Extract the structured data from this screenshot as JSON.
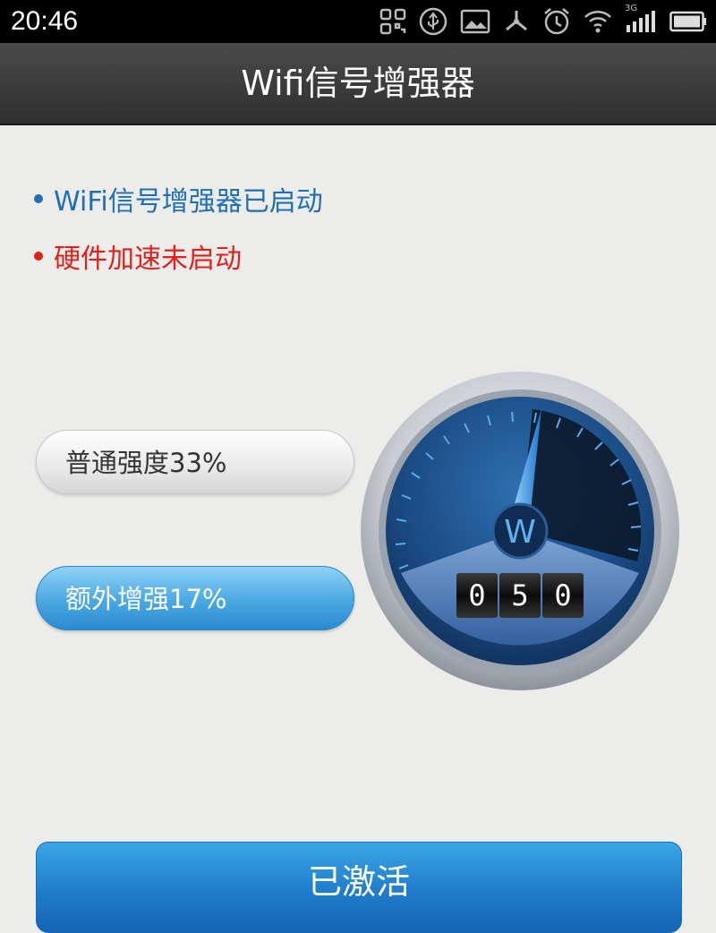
{
  "status_bar": {
    "time": "20:46",
    "network": "3G",
    "icons": [
      "qr-icon",
      "usb-icon",
      "image-icon",
      "share-icon",
      "alarm-icon",
      "wifi-icon",
      "signal-icon",
      "battery-icon"
    ]
  },
  "header": {
    "title": "Wifi信号增强器"
  },
  "status": {
    "booster_status": "WiFi信号增强器已启动",
    "hardware_status": "硬件加速未启动"
  },
  "strength": {
    "normal_label": "普通强度33%",
    "extra_label": "额外增强17%"
  },
  "gauge": {
    "logo": "W",
    "digits": [
      "0",
      "5",
      "0"
    ]
  },
  "actions": {
    "activate_label": "已激活"
  },
  "colors": {
    "accent_blue": "#1f6fb6",
    "warning_red": "#e0201b",
    "button_blue": "#1f7ccb"
  }
}
